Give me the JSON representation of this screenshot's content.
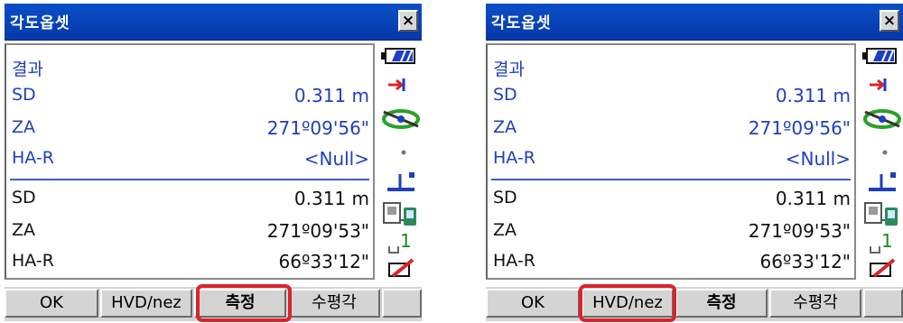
{
  "title": "각도옵셋",
  "close_label": "×",
  "result_heading": "결과",
  "measured": {
    "sd_label": "SD",
    "sd_value": "0.311 m",
    "za_label": "ZA",
    "za_value": "271º09'56\"",
    "har_label": "HA-R",
    "har_value": "<Null>"
  },
  "offset": {
    "sd_label": "SD",
    "sd_value": "0.311 m",
    "za_label": "ZA",
    "za_value": "271º09'53\"",
    "har_label": "HA-R",
    "har_value": "66º33'12\""
  },
  "softkeys": {
    "ok": "OK",
    "hvd_nez": "HVD/nez",
    "measure": "측정",
    "horizontal_angle": "수평각",
    "empty": ""
  },
  "status_icons": [
    "battery-icon",
    "target-prism-icon",
    "tilt-level-icon",
    "dot-icon",
    "stake-point-icon",
    "controller-link-icon",
    "prism-constant-1-icon",
    "edit-icon"
  ],
  "status_prism_number": "1",
  "highlights": {
    "left_screen": "measure-button",
    "right_screen": "hvd-nez-button"
  },
  "colors": {
    "titlebar": "#0a4fc9",
    "result_text": "#1f3fc0",
    "highlight": "#d9252a"
  }
}
